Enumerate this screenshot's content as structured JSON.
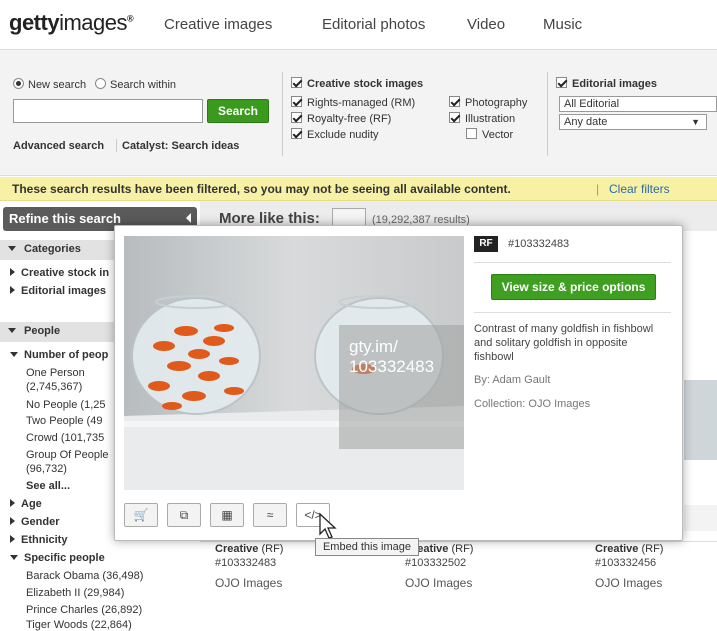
{
  "header": {
    "logo_bold": "getty",
    "logo_light": "images",
    "logo_reg": "®",
    "nav": [
      "Creative images",
      "Editorial photos",
      "Video",
      "Music"
    ]
  },
  "search": {
    "mode_new": "New search",
    "mode_within": "Search within",
    "input_value": "",
    "button": "Search",
    "advanced": "Advanced search",
    "catalyst": "Catalyst: Search ideas"
  },
  "creative": {
    "heading": "Creative stock images",
    "rm": "Rights-managed (RM)",
    "rf": "Royalty-free (RF)",
    "nudity": "Exclude nudity",
    "photography": "Photography",
    "illustration": "Illustration",
    "vector": "Vector"
  },
  "editorial": {
    "heading": "Editorial images",
    "select_all": "All Editorial",
    "select_date": "Any date"
  },
  "banner": {
    "text": "These search results have been filtered, so you may not be seeing all available content.",
    "sep": "|",
    "clear": "Clear filters"
  },
  "sidebar": {
    "refine": "Refine this search",
    "categories": "Categories",
    "cat_items": [
      "Creative stock in",
      "Editorial images"
    ],
    "people": "People",
    "num_people": "Number of peop",
    "sub_items": [
      "One Person",
      "(2,745,367)",
      "No People (1,25",
      "Two People (49",
      "Crowd (101,735",
      "Group Of People",
      "(96,732)"
    ],
    "see_all": "See all...",
    "age": "Age",
    "gender": "Gender",
    "ethnicity": "Ethnicity",
    "specific": "Specific people",
    "specific_items": [
      "Barack Obama (36,498)",
      "Elizabeth II (29,984)",
      "Prince Charles (26,892)",
      "Tiger Woods (22,864)"
    ]
  },
  "main": {
    "more_like": "More like this:",
    "count": "(19,292,387 results)"
  },
  "popup": {
    "badge": "RF",
    "image_id": "#103332483",
    "view_button": "View size & price options",
    "overlay_line1": "gty.im/",
    "overlay_line2": "103332483",
    "description": "Contrast of many goldfish in fishbowl and solitary goldfish in opposite fishbowl",
    "by": "By: Adam Gault",
    "collection": "Collection: OJO Images",
    "tooltip": "Embed this image"
  },
  "results": [
    {
      "type": "Creative",
      "rf": "(RF)",
      "id": "#103332483",
      "collection": "OJO Images"
    },
    {
      "type": "Creative",
      "rf": "(RF)",
      "id": "#103332502",
      "collection": "OJO Images"
    },
    {
      "type": "Creative",
      "rf": "(RF)",
      "id": "#103332456",
      "collection": "OJO Images"
    }
  ],
  "colors": {
    "accent_green": "#3a9a1e",
    "banner_yellow": "#f7f1a6",
    "link_blue": "#2a6aa8"
  }
}
